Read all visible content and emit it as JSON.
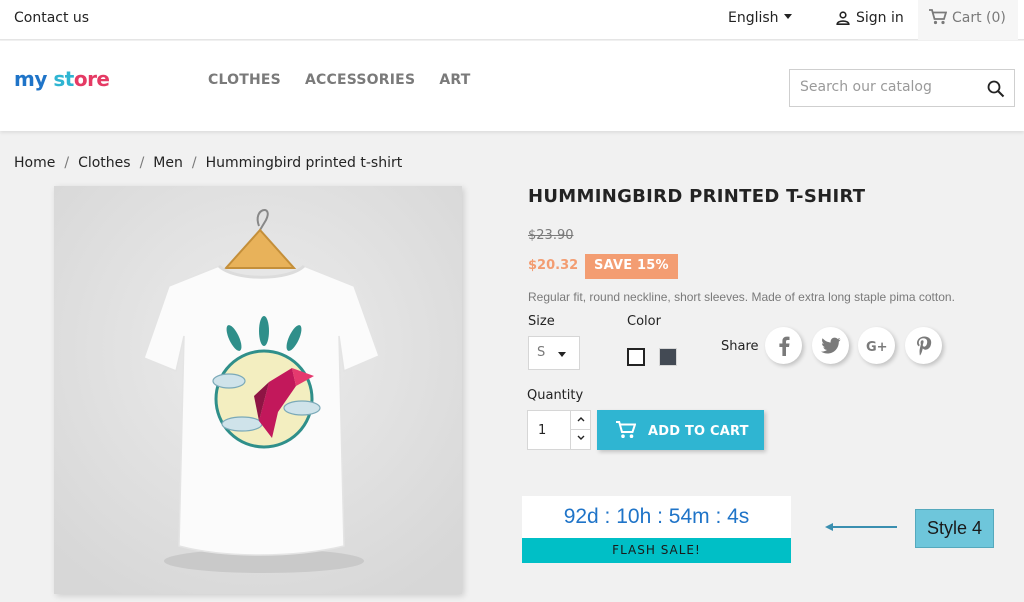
{
  "topbar": {
    "contact_label": "Contact us",
    "language_label": "English",
    "signin_label": "Sign in",
    "cart_label": "Cart (0)"
  },
  "header": {
    "logo": {
      "part1": "my",
      "part2": "st",
      "part3": "ore"
    },
    "nav": [
      "CLOTHES",
      "ACCESSORIES",
      "ART"
    ],
    "search_placeholder": "Search our catalog"
  },
  "breadcrumb": [
    "Home",
    "Clothes",
    "Men",
    "Hummingbird printed t-shirt"
  ],
  "product": {
    "title": "HUMMINGBIRD PRINTED T-SHIRT",
    "old_price": "$23.90",
    "price": "$20.32",
    "discount_badge": "SAVE 15%",
    "description": "Regular fit, round neckline, short sleeves. Made of extra long staple pima cotton.",
    "size_label": "Size",
    "size_value": "S",
    "color_label": "Color",
    "colors": [
      "#ffffff",
      "#434a54"
    ],
    "share_label": "Share",
    "share_icons": [
      "facebook-icon",
      "twitter-icon",
      "google-plus-icon",
      "pinterest-icon"
    ],
    "quantity_label": "Quantity",
    "quantity_value": "1",
    "add_to_cart_label": "ADD TO CART"
  },
  "countdown": {
    "timer_text": "92d : 10h : 54m : 4s",
    "flash_label": "FLASH SALE!",
    "style_tag": "Style 4"
  },
  "colors": {
    "accent": "#2fb5d2",
    "discount": "#f39d72",
    "timer": "#1f74c8",
    "flash_bar": "#00bfc6",
    "style_tag": "#6ec6db"
  }
}
